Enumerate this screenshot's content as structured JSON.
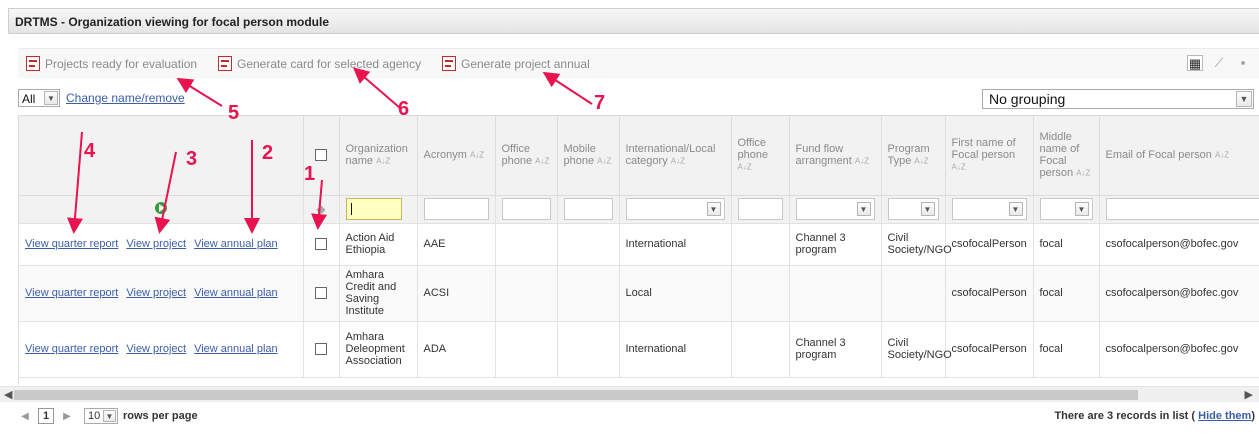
{
  "window": {
    "title": "DRTMS - Organization viewing for focal person module"
  },
  "toolbar": {
    "buttons": [
      "Projects ready for evaluation",
      "Generate card for selected agency",
      "Generate project annual"
    ],
    "view_icons": [
      "grid-view-icon",
      "chart-view-icon",
      "tile-view-icon"
    ]
  },
  "filter": {
    "all_label": "All",
    "change_link": "Change name/remove",
    "grouping": "No grouping"
  },
  "grid": {
    "columns": [
      "Organization name",
      "Acronym",
      "Office phone",
      "Mobile phone",
      "International/Local category",
      "Office phone",
      "Fund flow arrangment",
      "Program Type",
      "First name of Focal person",
      "Middle name of Focal person",
      "Email of Focal person"
    ],
    "action_links": [
      "View quarter report",
      "View project",
      "View annual plan"
    ],
    "rows": [
      [
        "Action Aid Ethiopia",
        "AAE",
        "",
        "",
        "International",
        "",
        "Channel 3 program",
        "Civil Society/NGO",
        "csofocalPerson",
        "focal",
        "csofocalperson@bofec.gov"
      ],
      [
        "Amhara Credit and Saving Institute",
        "ACSI",
        "",
        "",
        "Local",
        "",
        "",
        "",
        "csofocalPerson",
        "focal",
        "csofocalperson@bofec.gov"
      ],
      [
        "Amhara Deleopment Association",
        "ADA",
        "",
        "",
        "International",
        "",
        "Channel 3 program",
        "Civil Society/NGO",
        "csofocalPerson",
        "focal",
        "csofocalperson@bofec.gov"
      ]
    ]
  },
  "pager": {
    "page": "1",
    "rows_per_page": "10",
    "rows_label": "rows per page"
  },
  "footer": {
    "records_text": "There are 3 records in list (",
    "hide_link": "Hide them",
    "close_paren": ")"
  },
  "annotations": [
    "1",
    "2",
    "3",
    "4",
    "5",
    "6",
    "7"
  ],
  "colors": {
    "annotation": "#e8134f",
    "link": "#3b5ea8"
  }
}
